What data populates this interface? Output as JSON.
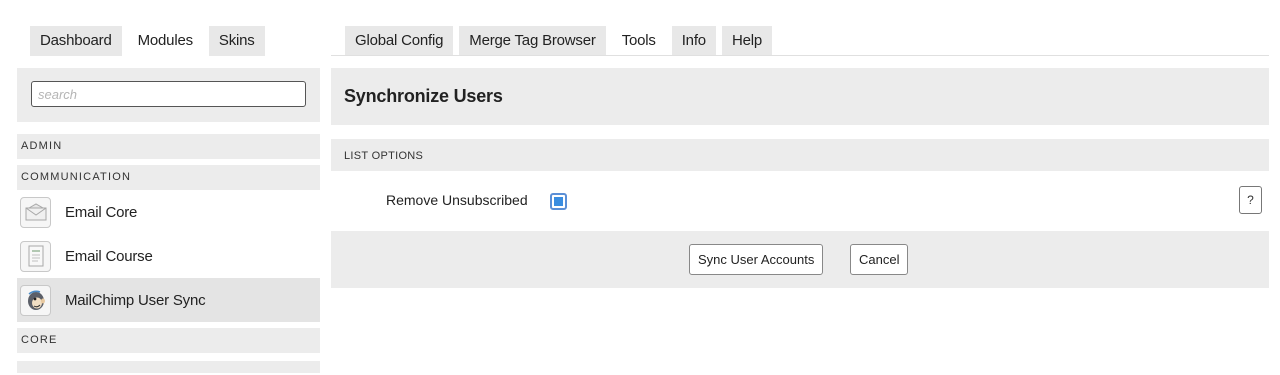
{
  "left_tabs": [
    {
      "label": "Dashboard",
      "active": false
    },
    {
      "label": "Modules",
      "active": true
    },
    {
      "label": "Skins",
      "active": false
    }
  ],
  "right_tabs": [
    {
      "label": "Global Config",
      "active": false
    },
    {
      "label": "Merge Tag Browser",
      "active": false
    },
    {
      "label": "Tools",
      "active": true
    },
    {
      "label": "Info",
      "active": false
    },
    {
      "label": "Help",
      "active": false
    }
  ],
  "sidebar": {
    "search": {
      "placeholder": "search",
      "value": ""
    },
    "categories": {
      "admin": "ADMIN",
      "communication": "COMMUNICATION",
      "core": "CORE"
    },
    "items": [
      {
        "label": "Email Core",
        "icon": "envelope-icon",
        "active": false
      },
      {
        "label": "Email Course",
        "icon": "document-icon",
        "active": false
      },
      {
        "label": "MailChimp User Sync",
        "icon": "mailchimp-icon",
        "active": true
      }
    ]
  },
  "main": {
    "title": "Synchronize Users",
    "section_title": "LIST OPTIONS",
    "option_label": "Remove Unsubscribed",
    "option_checked": true,
    "help_label": "?",
    "buttons": {
      "sync": "Sync User Accounts",
      "cancel": "Cancel"
    }
  },
  "colors": {
    "panel": "#ececec",
    "accent": "#3a8de0"
  }
}
